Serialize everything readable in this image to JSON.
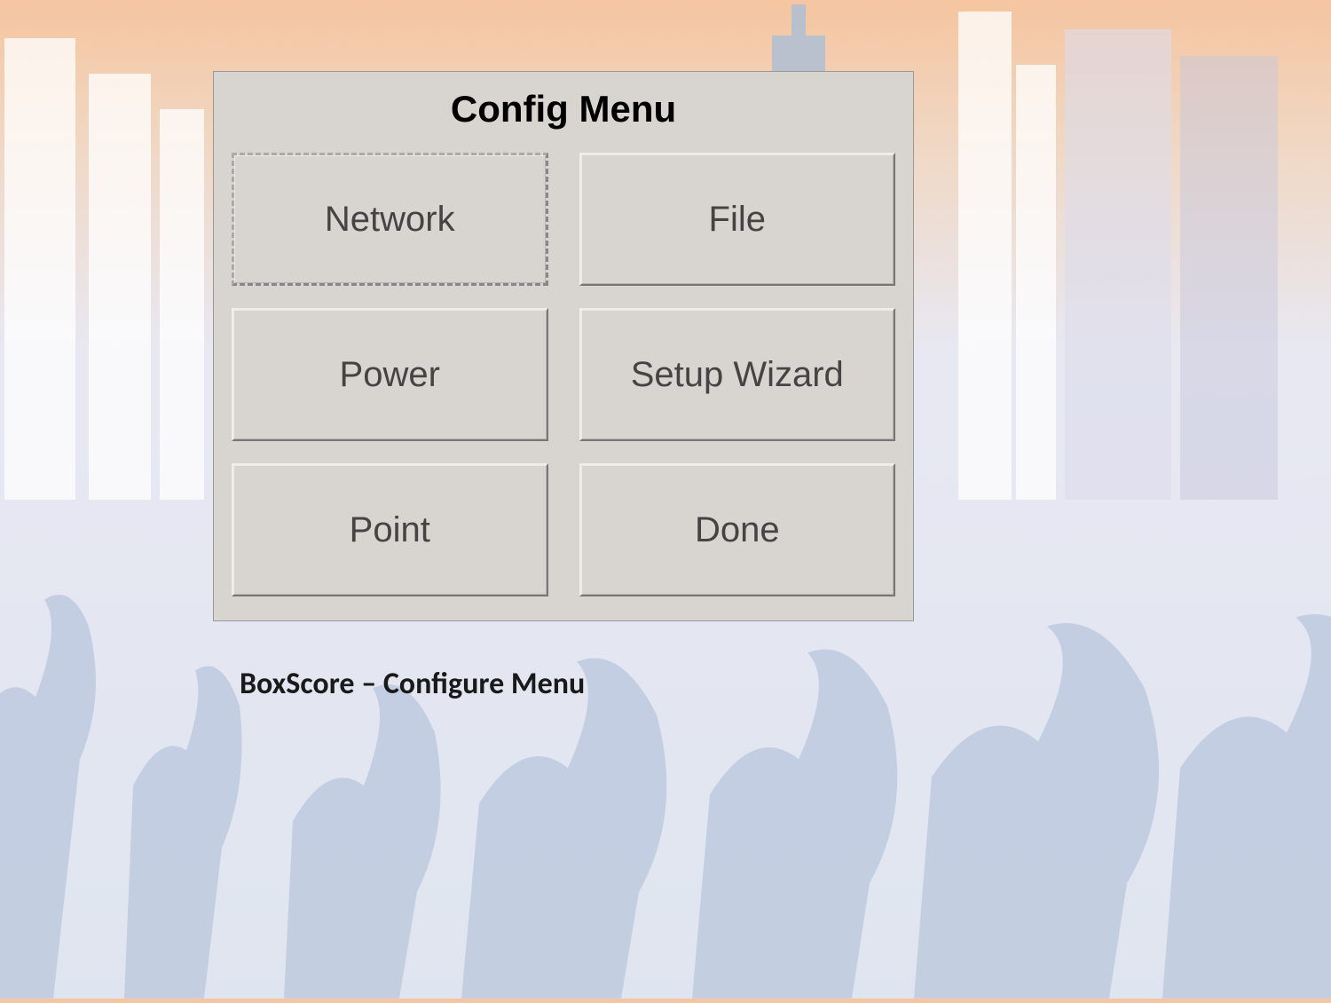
{
  "menu": {
    "title": "Config Menu",
    "buttons": {
      "network": "Network",
      "file": "File",
      "power": "Power",
      "setup_wizard": "Setup Wizard",
      "point": "Point",
      "done": "Done"
    }
  },
  "caption": "BoxScore – Configure Menu"
}
